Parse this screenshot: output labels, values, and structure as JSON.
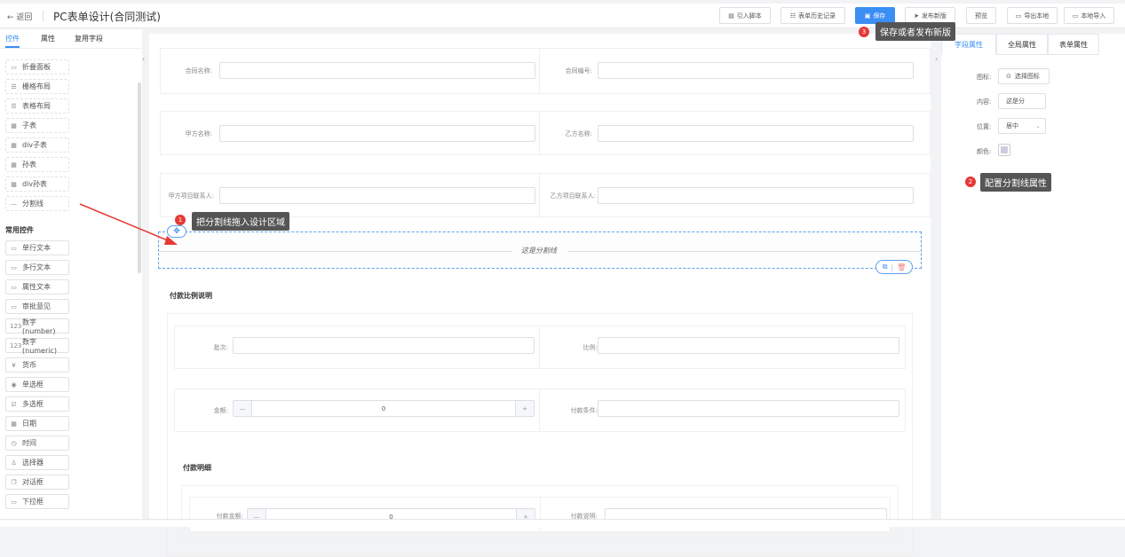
{
  "header": {
    "back": "返回",
    "title": "PC表单设计(合同测试)",
    "buttons": [
      {
        "icon": "script-icon",
        "glyph": "▤",
        "label": "引入脚本"
      },
      {
        "icon": "history-icon",
        "glyph": "☷",
        "label": "表单历史记录"
      },
      {
        "icon": "save-icon",
        "glyph": "🖫",
        "label": "保存"
      },
      {
        "icon": "send-icon",
        "glyph": "➤",
        "label": "发布新版"
      },
      {
        "icon": "",
        "glyph": "",
        "label": "预览"
      },
      {
        "icon": "folder-icon",
        "glyph": "▭",
        "label": "导出本地"
      },
      {
        "icon": "folder-open-icon",
        "glyph": "▭",
        "label": "本地导入"
      }
    ]
  },
  "tooltips": {
    "t1": {
      "num": "1",
      "text": "把分割线拖入设计区域"
    },
    "t2": {
      "num": "2",
      "text": "配置分割线属性"
    },
    "t3": {
      "num": "3",
      "text": "保存或者发布新版"
    }
  },
  "left": {
    "tabs": [
      "控件",
      "属性",
      "复用字段"
    ],
    "layout_items": [
      {
        "g": "▭",
        "label": "折叠面板"
      },
      {
        "g": "☰",
        "label": "栅格布局"
      },
      {
        "g": "☰",
        "label": "表格布局"
      },
      {
        "g": "▦",
        "label": "子表"
      },
      {
        "g": "▦",
        "label": "div子表"
      },
      {
        "g": "▦",
        "label": "孙表"
      },
      {
        "g": "▦",
        "label": "div孙表"
      },
      {
        "g": "—",
        "label": "分割线"
      }
    ],
    "common_title": "常用控件",
    "common_items": [
      {
        "g": "▭",
        "label": "单行文本"
      },
      {
        "g": "▭",
        "label": "多行文本"
      },
      {
        "g": "▭",
        "label": "属性文本"
      },
      {
        "g": "▭",
        "label": "审批意见"
      },
      {
        "g": "123",
        "label": "数字(number)"
      },
      {
        "g": "123",
        "label": "数字(numeric)"
      },
      {
        "g": "¥",
        "label": "货币"
      },
      {
        "g": "◉",
        "label": "单选框"
      },
      {
        "g": "☑",
        "label": "多选框"
      },
      {
        "g": "▦",
        "label": "日期"
      },
      {
        "g": "◷",
        "label": "时间"
      },
      {
        "g": "♙",
        "label": "选择器"
      },
      {
        "g": "❐",
        "label": "对话框"
      },
      {
        "g": "▭",
        "label": "下拉框"
      }
    ]
  },
  "canvas": {
    "rows": [
      [
        "合同名称:",
        "合同编号:"
      ],
      [
        "甲方名称:",
        "乙方名称:"
      ],
      [
        "甲方项目联系人:",
        "乙方项目联系人:"
      ]
    ],
    "divider_text": "这是分割线",
    "section1": "付款比例说明",
    "s1_labels": {
      "batch": "批次:",
      "ratio": "比例:",
      "amount": "金额:",
      "amount_value": "0",
      "cond": "付款条件:"
    },
    "section2": "付款明细",
    "s2_labels": {
      "amount": "付款金额:",
      "amount_value": "0",
      "desc": "付款说明:"
    },
    "minus": "—",
    "plus": "+"
  },
  "right": {
    "tabs": [
      "字段属性",
      "全局属性",
      "表单属性"
    ],
    "icon_label": "图标:",
    "icon_btn": "选择图标",
    "content_label": "内容:",
    "content_value": "这是分",
    "position_label": "位置:",
    "position_value": "居中",
    "color_label": "颜色:"
  },
  "colors": {
    "primary": "#3b8ef3",
    "badge": "#e53935"
  }
}
